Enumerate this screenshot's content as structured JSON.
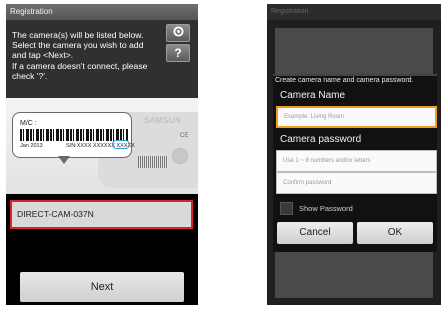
{
  "left_screen": {
    "title": "Registration",
    "instructions": "The camera(s) will be listed below.\nSelect the camera you wish to add\nand tap <Next>.\nIf a camera doesn't connect, please\ncheck '?'.",
    "refresh_icon": "refresh-icon",
    "help_label": "?",
    "camera_label": {
      "mc_text": "M/C :",
      "date_text": "Jan 2013",
      "sn_text": "S/N:XXXX XXXXXX XXXXX",
      "brand_text": "SAMSUN",
      "cert_text": "CE"
    },
    "selected_camera": "DIRECT-CAM-037N",
    "next_label": "Next",
    "highlight_color": "#e0202b"
  },
  "right_screen": {
    "title": "Registration",
    "dialog_header": "Create camera name and camera password.",
    "camera_name_label": "Camera Name",
    "camera_name_placeholder": "Example: Living Room",
    "camera_password_label": "Camera password",
    "password_placeholder": "Use 1 ~ 8 numbers and/or letters",
    "confirm_placeholder": "Confirm password",
    "show_password_label": "Show Password",
    "cancel_label": "Cancel",
    "ok_label": "OK",
    "focus_color": "#f29b1e"
  }
}
